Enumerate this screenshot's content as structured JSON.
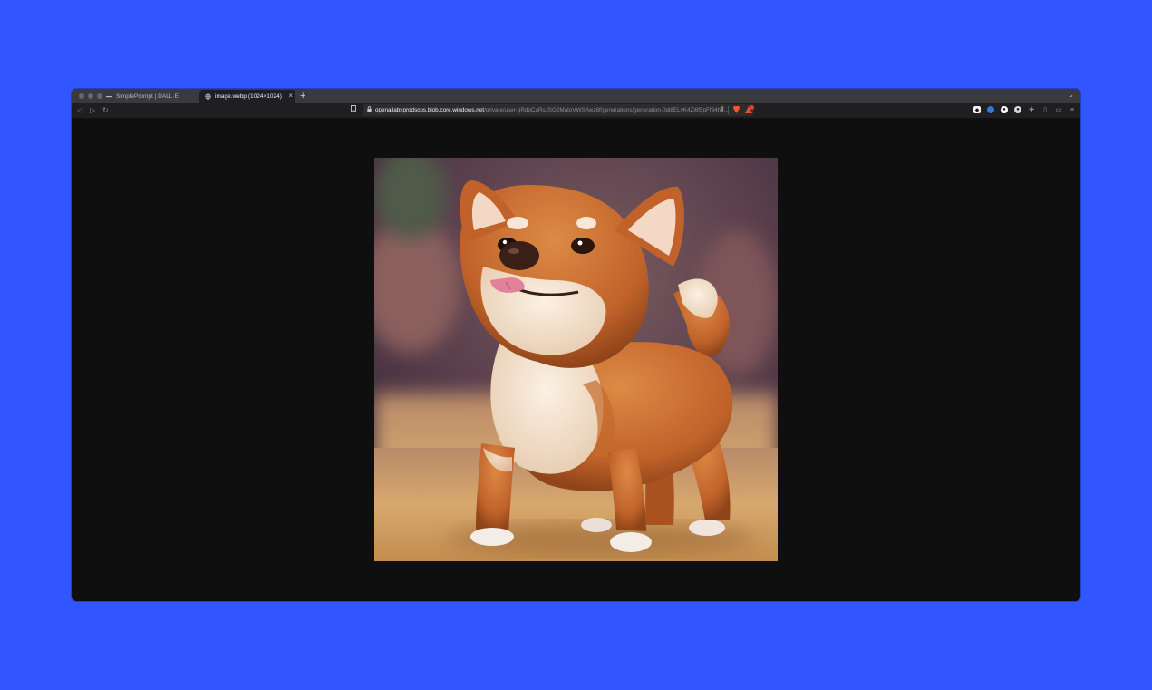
{
  "browser": {
    "tabs": [
      {
        "title": "SimplePrompt | DALL·E",
        "active": false,
        "icon": "dash-favicon"
      },
      {
        "title": "image.webp (1024×1024)",
        "active": true,
        "icon": "globe-favicon"
      }
    ],
    "address_bar": {
      "host": "openailabsprodscus.blob.core.windows.net",
      "path": "/private/user-qRdpCaRsJSG2MatoVWSAwz6f/generations/generation-0di8ELvK4Zi6f5pFf64h3..."
    }
  },
  "content": {
    "image_subject": "shiba-inu-dog-render",
    "colors": {
      "page_background": "#3155fe",
      "viewer_background": "#0f0f10",
      "fur_orange": "#c6692a",
      "fur_cream": "#f3e2cc"
    }
  }
}
